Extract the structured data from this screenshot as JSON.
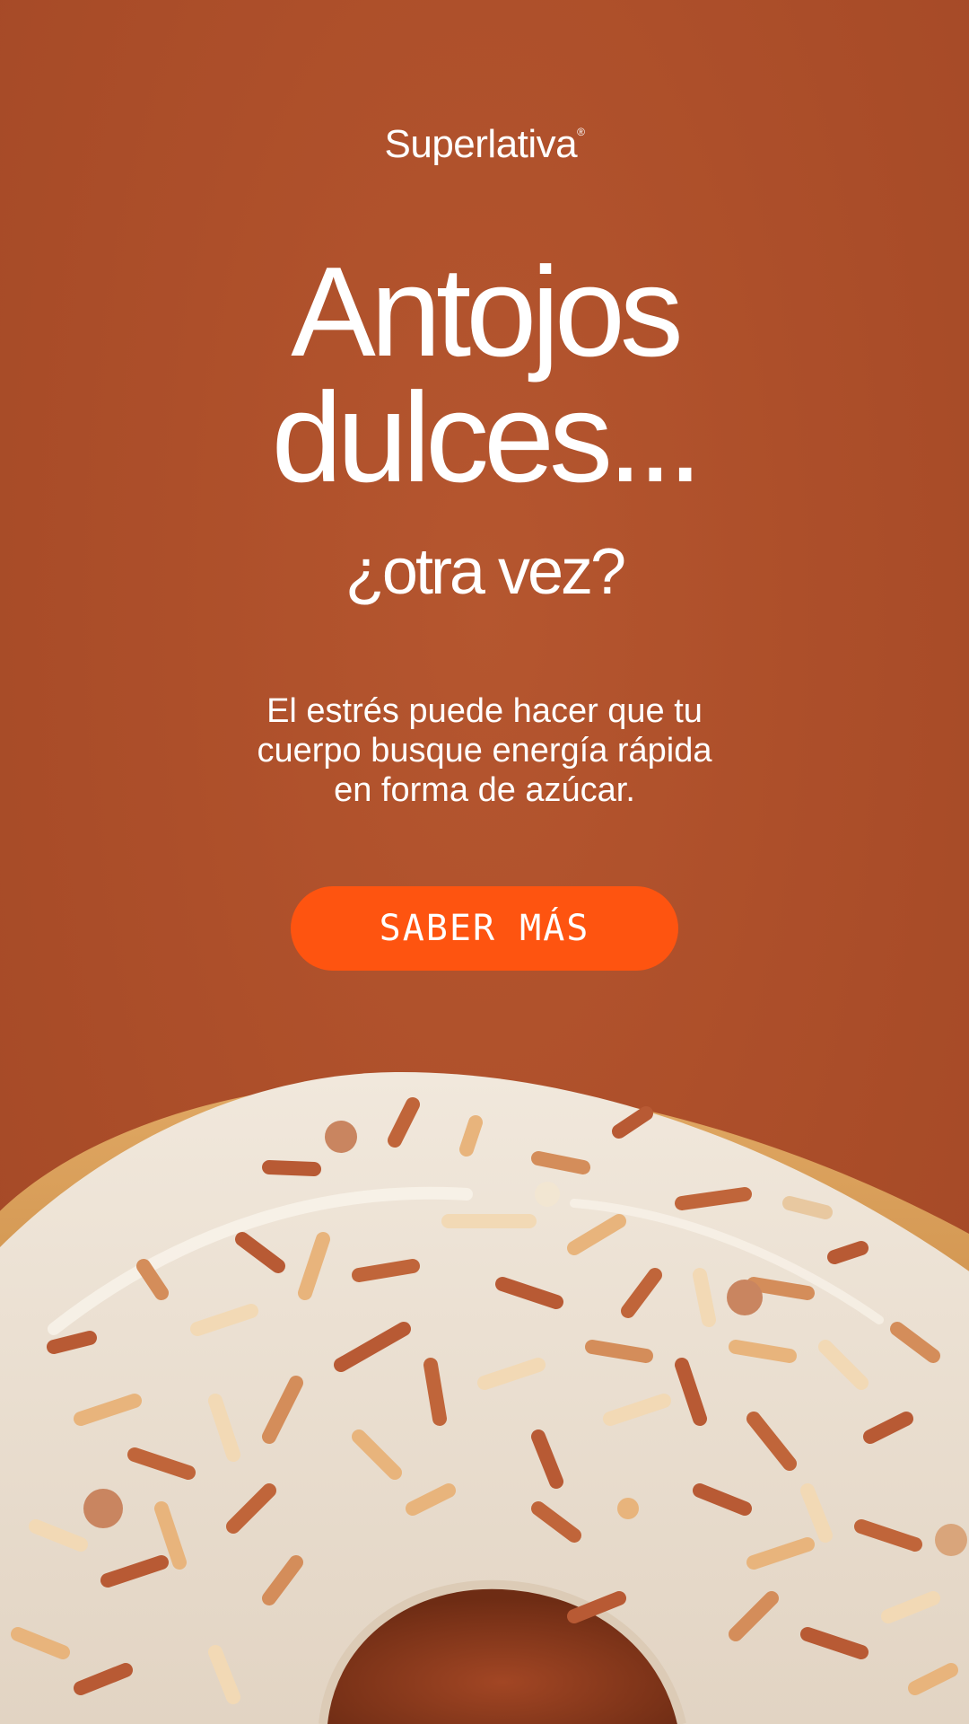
{
  "brand": {
    "name": "Superlativa",
    "trademark": "®"
  },
  "hero": {
    "headline_line1": "Antojos",
    "headline_line2": "dulces...",
    "subheadline": "¿otra vez?",
    "body_line1": "El estrés puede hacer que tu",
    "body_line2": "cuerpo busque energía rápida",
    "body_line3": "en forma de azúcar."
  },
  "cta": {
    "label": "SABER MÁS"
  },
  "colors": {
    "background": "#ad4f2a",
    "cta": "#fe5410",
    "text": "#ffffff",
    "icing": "#ede3d6"
  }
}
